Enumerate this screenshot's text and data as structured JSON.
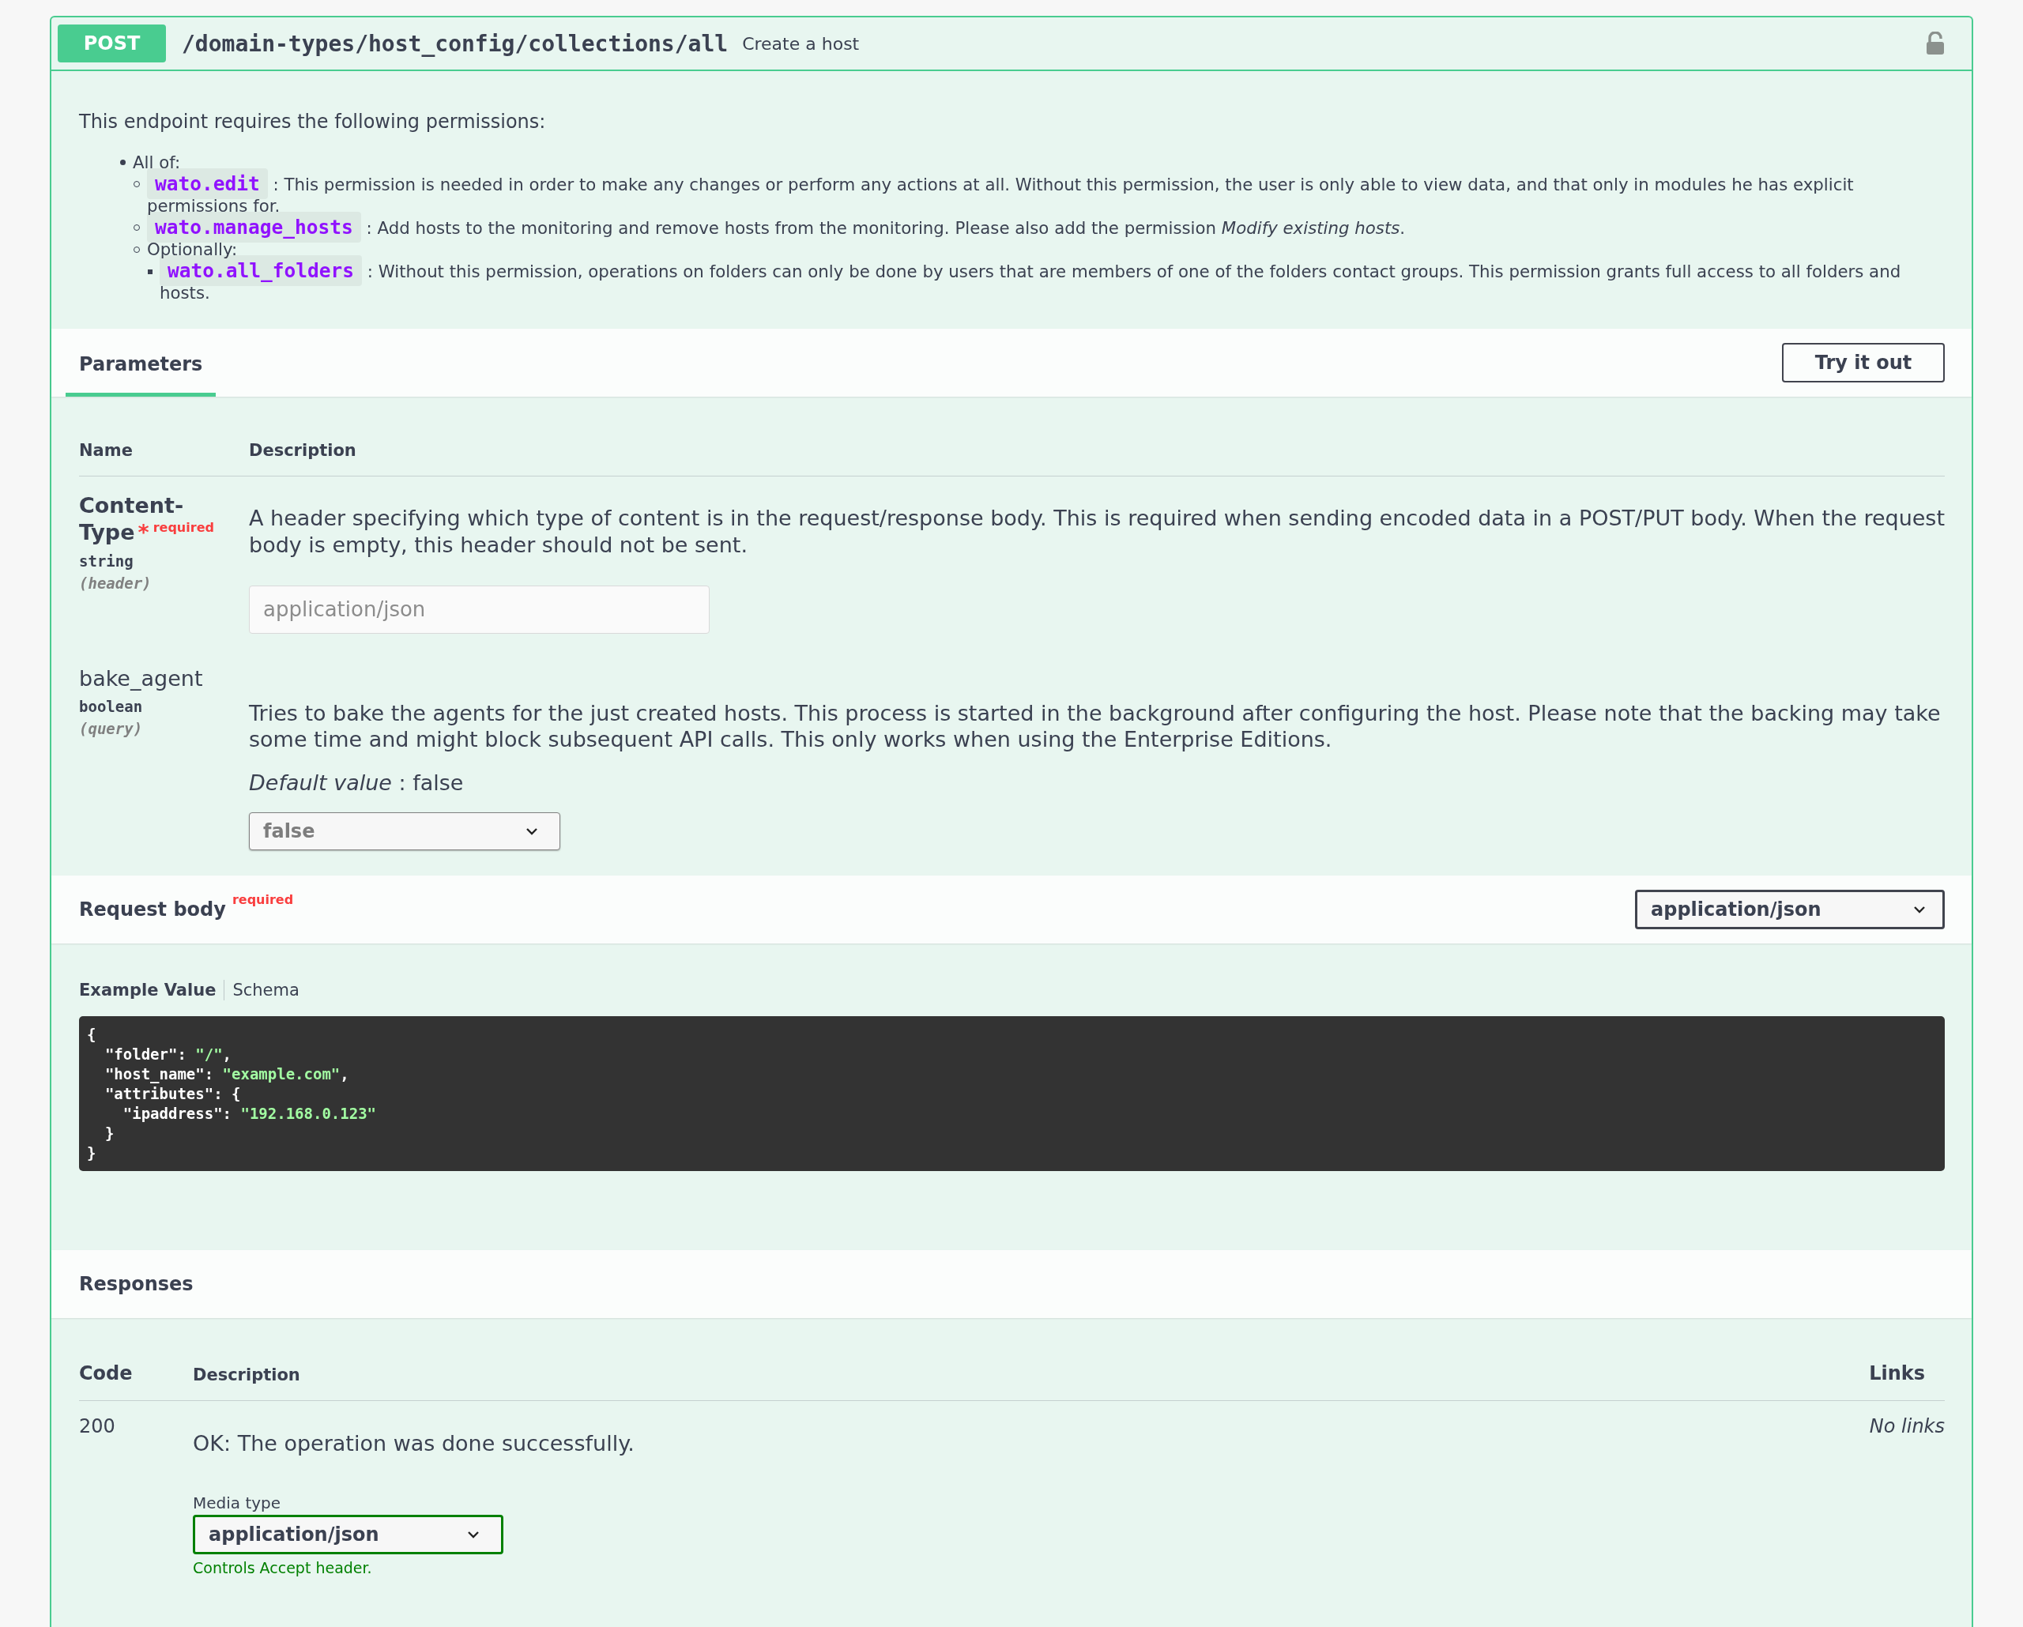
{
  "operation": {
    "method": "POST",
    "path": "/domain-types/host_config/collections/all",
    "summary": "Create a host"
  },
  "permissions": {
    "intro": "This endpoint requires the following permissions:",
    "items": [
      {
        "kind": "group",
        "label": "All of:",
        "children": [
          {
            "kind": "permission",
            "name": "wato.edit",
            "text": ": This permission is needed in order to make any changes or perform any actions at all. Without this permission, the user is only able to view data, and that only in modules he has explicit permissions for."
          },
          {
            "kind": "permission",
            "name": "wato.manage_hosts",
            "text": ": Add hosts to the monitoring and remove hosts from the monitoring. Please also add the permission *Modify existing hosts*."
          },
          {
            "kind": "group",
            "label": "Optionally:",
            "children": [
              {
                "kind": "permission",
                "name": "wato.all_folders",
                "text": ": Without this permission, operations on folders can only be done by users that are members of one of the folders contact groups. This permission grants full access to all folders and hosts."
              }
            ]
          }
        ]
      }
    ]
  },
  "parameters": {
    "tab": "Parameters",
    "try_button": "Try it out",
    "columns": [
      "Name",
      "Description"
    ],
    "rows": [
      {
        "name": "Content-Type",
        "required": true,
        "required_mark": "*",
        "required_label": "required",
        "type": "string",
        "location": "(header)",
        "description": "A header specifying which type of content is in the request/response body. This is required when sending encoded data in a POST/PUT body. When the request body is empty, this header should not be sent.",
        "kind": "input",
        "placeholder": "application/json"
      },
      {
        "name": "bake_agent",
        "required": false,
        "type": "boolean",
        "location": "(query)",
        "description": "Tries to bake the agents for the just created hosts. This process is started in the background after configuring the host. Please note that the backing may take some time and might block subsequent API calls. This only works when using the Enterprise Editions.",
        "default": "*Default value* : false",
        "kind": "select",
        "value": "false"
      }
    ]
  },
  "request_body": {
    "title": "Request body",
    "required_label": "required",
    "content_type": "application/json",
    "tabs": [
      {
        "label": "Example Value",
        "selected": true
      },
      {
        "label": "Schema",
        "selected": false
      }
    ],
    "example": [
      [
        {
          "text": "{",
          "kind": "plain"
        }
      ],
      [
        {
          "text": "  \"folder\": ",
          "kind": "plain"
        },
        {
          "text": "\"/\"",
          "kind": "string"
        },
        {
          "text": ",",
          "kind": "plain"
        }
      ],
      [
        {
          "text": "  \"host_name\": ",
          "kind": "plain"
        },
        {
          "text": "\"example.com\"",
          "kind": "string"
        },
        {
          "text": ",",
          "kind": "plain"
        }
      ],
      [
        {
          "text": "  \"attributes\": {",
          "kind": "plain"
        }
      ],
      [
        {
          "text": "    \"ipaddress\": ",
          "kind": "plain"
        },
        {
          "text": "\"192.168.0.123\"",
          "kind": "string"
        }
      ],
      [
        {
          "text": "  }",
          "kind": "plain"
        }
      ],
      [
        {
          "text": "}",
          "kind": "plain"
        }
      ]
    ]
  },
  "responses": {
    "title": "Responses",
    "columns": [
      "Code",
      "Description",
      "Links"
    ],
    "rows": [
      {
        "code": "200",
        "description": "OK: The operation was done successfully.",
        "media_type_label": "Media type",
        "media_type": "application/json",
        "media_hint": "Controls Accept header.",
        "links": "No links"
      }
    ]
  }
}
